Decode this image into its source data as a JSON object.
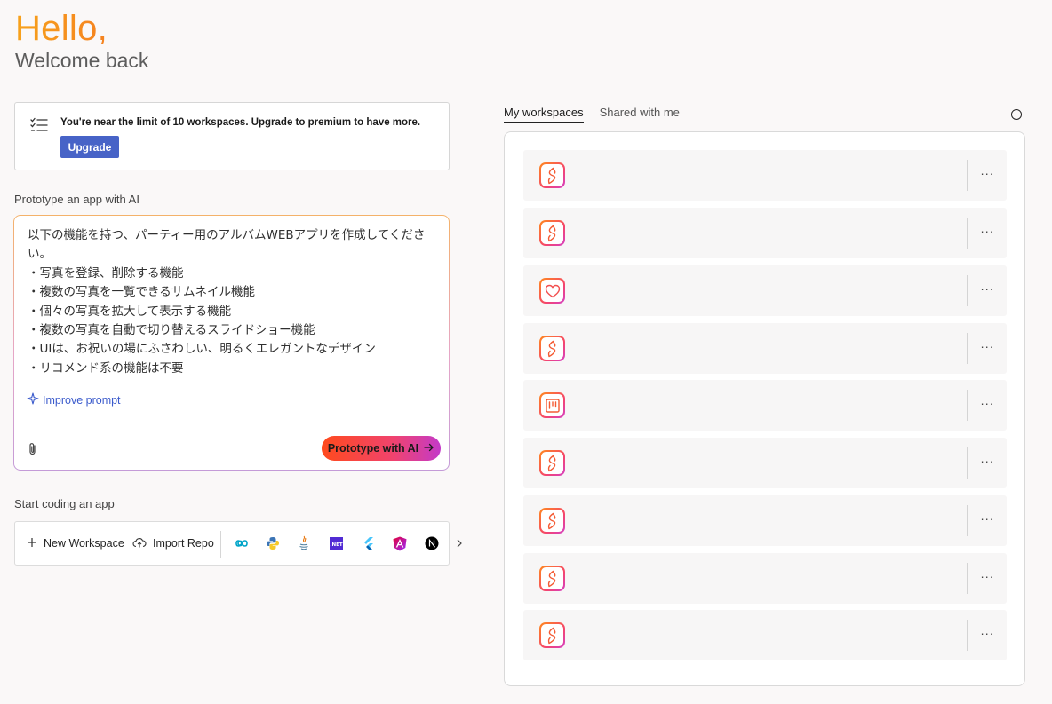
{
  "greeting": {
    "hello": "Hello,",
    "welcome": "Welcome back"
  },
  "limit_notice": {
    "icon": "checklist-icon",
    "message": "You're near the limit of 10 workspaces. Upgrade to premium to have more.",
    "upgrade_label": "Upgrade"
  },
  "prototype": {
    "section_label": "Prototype an app with AI",
    "prompt_value": "以下の機能を持つ、パーティー用のアルバムWEBアプリを作成してください。\n・写真を登録、削除する機能\n・複数の写真を一覧できるサムネイル機能\n・個々の写真を拡大して表示する機能\n・複数の写真を自動で切り替えるスライドショー機能\n・UIは、お祝いの場にふさわしい、明るくエレガントなデザイン\n・リコメンド系の機能は不要",
    "improve_label": "Improve prompt",
    "submit_label": "Prototype with AI",
    "colors": {
      "gradient_start": "#ff4a1c",
      "gradient_end": "#c43ac9"
    }
  },
  "coding": {
    "section_label": "Start coding an app",
    "new_workspace_label": "New Workspace",
    "import_repo_label": "Import Repo",
    "templates": [
      "blank-template-icon",
      "python-icon",
      "java-icon",
      "dotnet-icon",
      "flutter-icon",
      "angular-icon",
      "nextjs-icon"
    ],
    "dotnet_badge": ".NET"
  },
  "workspaces": {
    "tabs": [
      {
        "label": "My workspaces",
        "active": true
      },
      {
        "label": "Shared with me",
        "active": false
      }
    ],
    "items": [
      {
        "icon": "spark-icon"
      },
      {
        "icon": "spark-icon"
      },
      {
        "icon": "heart-icon"
      },
      {
        "icon": "spark-icon"
      },
      {
        "icon": "board-icon"
      },
      {
        "icon": "spark-icon"
      },
      {
        "icon": "spark-icon"
      },
      {
        "icon": "spark-icon"
      },
      {
        "icon": "spark-icon"
      }
    ],
    "more_label": "···"
  }
}
